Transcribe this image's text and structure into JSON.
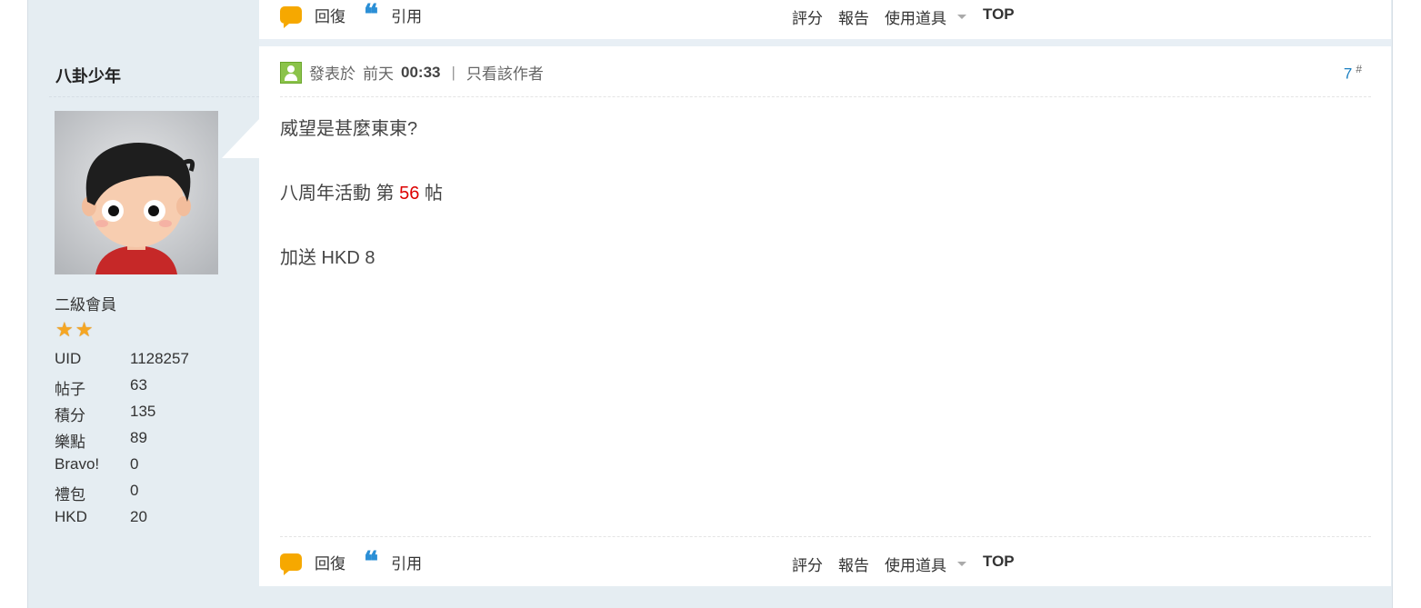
{
  "actions": {
    "reply": "回復",
    "quote": "引用",
    "rate": "評分",
    "report": "報告",
    "tools": "使用道具",
    "top": "TOP"
  },
  "user": {
    "name": "八卦少年",
    "rank": "二級會員",
    "star_count": 2,
    "stats": [
      {
        "label": "UID",
        "value": "1128257"
      },
      {
        "label": "帖子",
        "value": "63"
      },
      {
        "label": "積分",
        "value": "135"
      },
      {
        "label": "樂點",
        "value": "89"
      },
      {
        "label": "Bravo!",
        "value": "0"
      },
      {
        "label": "禮包",
        "value": "0"
      },
      {
        "label": "HKD",
        "value": "20"
      }
    ]
  },
  "post": {
    "posted_prefix": "發表於",
    "posted_day": "前天",
    "posted_time": "00:33",
    "separator": "|",
    "only_author": "只看該作者",
    "floor": "7",
    "floor_mark": "#",
    "line1": "威望是甚麼東東?",
    "line2_pre": "八周年活動 第",
    "line2_num": "56",
    "line2_post": "帖",
    "line3": "加送 HKD 8"
  },
  "colors": {
    "accent_blue": "#1a7fc1",
    "highlight_red": "#dd0000",
    "sidebar_bg": "#e5edf2"
  }
}
